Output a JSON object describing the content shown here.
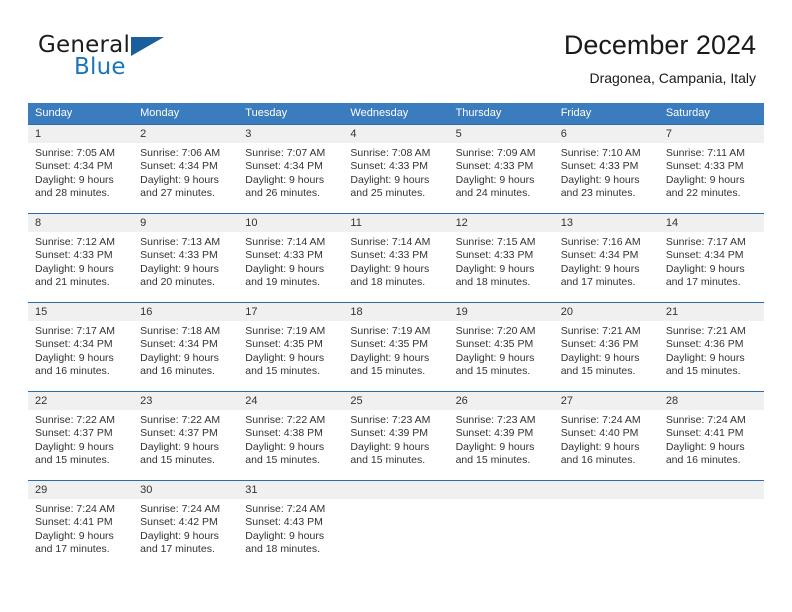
{
  "brand": {
    "name_part1": "General",
    "name_part2": "Blue",
    "mark": "triangle-logo",
    "accent_color": "#1b75bb"
  },
  "header": {
    "title": "December 2024",
    "subtitle": "Dragonea, Campania, Italy"
  },
  "colors": {
    "header_row_bg": "#3a7cbe",
    "row_divider": "#2d6ca8",
    "daynum_band_bg": "#f0f0f0",
    "text": "#333333"
  },
  "weekdays": [
    "Sunday",
    "Monday",
    "Tuesday",
    "Wednesday",
    "Thursday",
    "Friday",
    "Saturday"
  ],
  "weeks": [
    [
      {
        "day": "1",
        "l1": "Sunrise: 7:05 AM",
        "l2": "Sunset: 4:34 PM",
        "l3": "Daylight: 9 hours",
        "l4": "and 28 minutes."
      },
      {
        "day": "2",
        "l1": "Sunrise: 7:06 AM",
        "l2": "Sunset: 4:34 PM",
        "l3": "Daylight: 9 hours",
        "l4": "and 27 minutes."
      },
      {
        "day": "3",
        "l1": "Sunrise: 7:07 AM",
        "l2": "Sunset: 4:34 PM",
        "l3": "Daylight: 9 hours",
        "l4": "and 26 minutes."
      },
      {
        "day": "4",
        "l1": "Sunrise: 7:08 AM",
        "l2": "Sunset: 4:33 PM",
        "l3": "Daylight: 9 hours",
        "l4": "and 25 minutes."
      },
      {
        "day": "5",
        "l1": "Sunrise: 7:09 AM",
        "l2": "Sunset: 4:33 PM",
        "l3": "Daylight: 9 hours",
        "l4": "and 24 minutes."
      },
      {
        "day": "6",
        "l1": "Sunrise: 7:10 AM",
        "l2": "Sunset: 4:33 PM",
        "l3": "Daylight: 9 hours",
        "l4": "and 23 minutes."
      },
      {
        "day": "7",
        "l1": "Sunrise: 7:11 AM",
        "l2": "Sunset: 4:33 PM",
        "l3": "Daylight: 9 hours",
        "l4": "and 22 minutes."
      }
    ],
    [
      {
        "day": "8",
        "l1": "Sunrise: 7:12 AM",
        "l2": "Sunset: 4:33 PM",
        "l3": "Daylight: 9 hours",
        "l4": "and 21 minutes."
      },
      {
        "day": "9",
        "l1": "Sunrise: 7:13 AM",
        "l2": "Sunset: 4:33 PM",
        "l3": "Daylight: 9 hours",
        "l4": "and 20 minutes."
      },
      {
        "day": "10",
        "l1": "Sunrise: 7:14 AM",
        "l2": "Sunset: 4:33 PM",
        "l3": "Daylight: 9 hours",
        "l4": "and 19 minutes."
      },
      {
        "day": "11",
        "l1": "Sunrise: 7:14 AM",
        "l2": "Sunset: 4:33 PM",
        "l3": "Daylight: 9 hours",
        "l4": "and 18 minutes."
      },
      {
        "day": "12",
        "l1": "Sunrise: 7:15 AM",
        "l2": "Sunset: 4:33 PM",
        "l3": "Daylight: 9 hours",
        "l4": "and 18 minutes."
      },
      {
        "day": "13",
        "l1": "Sunrise: 7:16 AM",
        "l2": "Sunset: 4:34 PM",
        "l3": "Daylight: 9 hours",
        "l4": "and 17 minutes."
      },
      {
        "day": "14",
        "l1": "Sunrise: 7:17 AM",
        "l2": "Sunset: 4:34 PM",
        "l3": "Daylight: 9 hours",
        "l4": "and 17 minutes."
      }
    ],
    [
      {
        "day": "15",
        "l1": "Sunrise: 7:17 AM",
        "l2": "Sunset: 4:34 PM",
        "l3": "Daylight: 9 hours",
        "l4": "and 16 minutes."
      },
      {
        "day": "16",
        "l1": "Sunrise: 7:18 AM",
        "l2": "Sunset: 4:34 PM",
        "l3": "Daylight: 9 hours",
        "l4": "and 16 minutes."
      },
      {
        "day": "17",
        "l1": "Sunrise: 7:19 AM",
        "l2": "Sunset: 4:35 PM",
        "l3": "Daylight: 9 hours",
        "l4": "and 15 minutes."
      },
      {
        "day": "18",
        "l1": "Sunrise: 7:19 AM",
        "l2": "Sunset: 4:35 PM",
        "l3": "Daylight: 9 hours",
        "l4": "and 15 minutes."
      },
      {
        "day": "19",
        "l1": "Sunrise: 7:20 AM",
        "l2": "Sunset: 4:35 PM",
        "l3": "Daylight: 9 hours",
        "l4": "and 15 minutes."
      },
      {
        "day": "20",
        "l1": "Sunrise: 7:21 AM",
        "l2": "Sunset: 4:36 PM",
        "l3": "Daylight: 9 hours",
        "l4": "and 15 minutes."
      },
      {
        "day": "21",
        "l1": "Sunrise: 7:21 AM",
        "l2": "Sunset: 4:36 PM",
        "l3": "Daylight: 9 hours",
        "l4": "and 15 minutes."
      }
    ],
    [
      {
        "day": "22",
        "l1": "Sunrise: 7:22 AM",
        "l2": "Sunset: 4:37 PM",
        "l3": "Daylight: 9 hours",
        "l4": "and 15 minutes."
      },
      {
        "day": "23",
        "l1": "Sunrise: 7:22 AM",
        "l2": "Sunset: 4:37 PM",
        "l3": "Daylight: 9 hours",
        "l4": "and 15 minutes."
      },
      {
        "day": "24",
        "l1": "Sunrise: 7:22 AM",
        "l2": "Sunset: 4:38 PM",
        "l3": "Daylight: 9 hours",
        "l4": "and 15 minutes."
      },
      {
        "day": "25",
        "l1": "Sunrise: 7:23 AM",
        "l2": "Sunset: 4:39 PM",
        "l3": "Daylight: 9 hours",
        "l4": "and 15 minutes."
      },
      {
        "day": "26",
        "l1": "Sunrise: 7:23 AM",
        "l2": "Sunset: 4:39 PM",
        "l3": "Daylight: 9 hours",
        "l4": "and 15 minutes."
      },
      {
        "day": "27",
        "l1": "Sunrise: 7:24 AM",
        "l2": "Sunset: 4:40 PM",
        "l3": "Daylight: 9 hours",
        "l4": "and 16 minutes."
      },
      {
        "day": "28",
        "l1": "Sunrise: 7:24 AM",
        "l2": "Sunset: 4:41 PM",
        "l3": "Daylight: 9 hours",
        "l4": "and 16 minutes."
      }
    ],
    [
      {
        "day": "29",
        "l1": "Sunrise: 7:24 AM",
        "l2": "Sunset: 4:41 PM",
        "l3": "Daylight: 9 hours",
        "l4": "and 17 minutes."
      },
      {
        "day": "30",
        "l1": "Sunrise: 7:24 AM",
        "l2": "Sunset: 4:42 PM",
        "l3": "Daylight: 9 hours",
        "l4": "and 17 minutes."
      },
      {
        "day": "31",
        "l1": "Sunrise: 7:24 AM",
        "l2": "Sunset: 4:43 PM",
        "l3": "Daylight: 9 hours",
        "l4": "and 18 minutes."
      },
      {
        "day": "",
        "l1": "",
        "l2": "",
        "l3": "",
        "l4": ""
      },
      {
        "day": "",
        "l1": "",
        "l2": "",
        "l3": "",
        "l4": ""
      },
      {
        "day": "",
        "l1": "",
        "l2": "",
        "l3": "",
        "l4": ""
      },
      {
        "day": "",
        "l1": "",
        "l2": "",
        "l3": "",
        "l4": ""
      }
    ]
  ]
}
